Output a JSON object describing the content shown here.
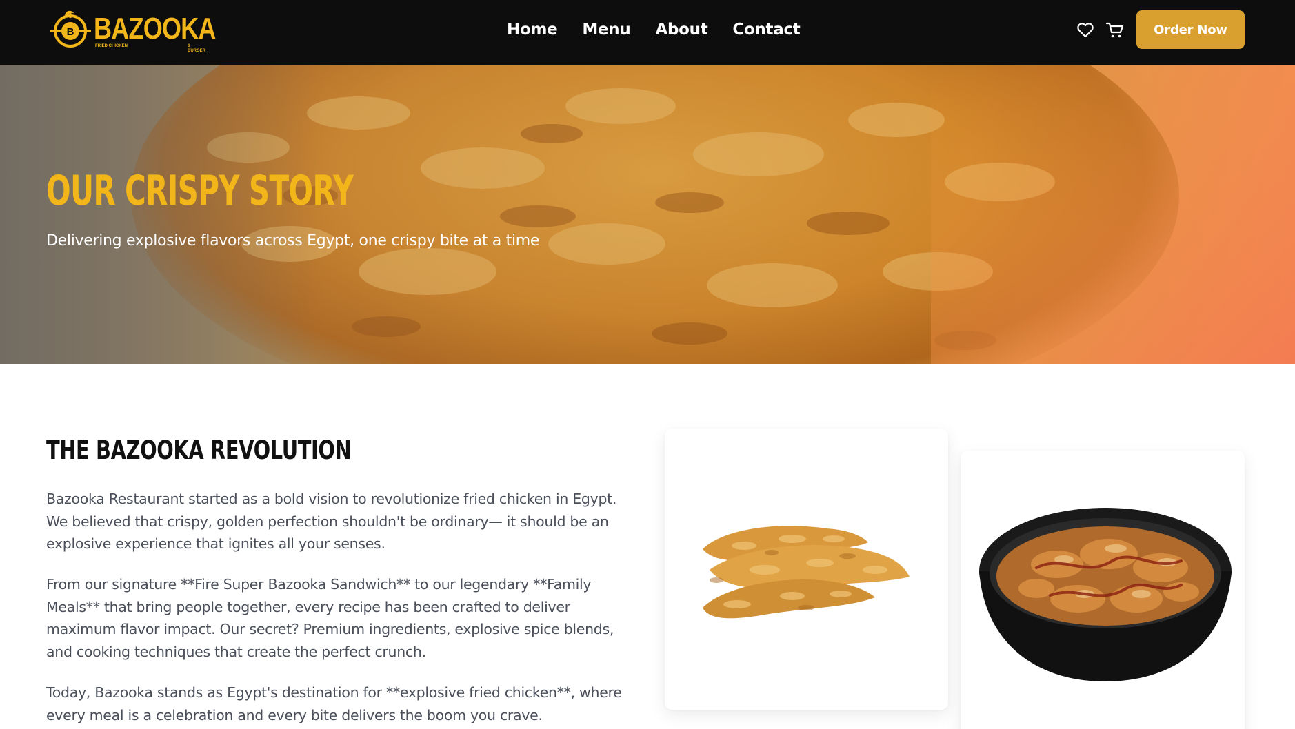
{
  "brand": {
    "name": "BAZOOKA",
    "tagline_left": "FRIED CHICKEN",
    "tagline_right": "& BURGER",
    "emblem_letter": "B",
    "accent_color": "#f2b51a"
  },
  "nav": {
    "links": [
      "Home",
      "Menu",
      "About",
      "Contact"
    ],
    "order_button": "Order Now",
    "icons": [
      "heart-icon",
      "cart-icon"
    ],
    "button_color": "#d9a02f"
  },
  "hero": {
    "title": "OUR CRISPY STORY",
    "subtitle": "Delivering explosive flavors across Egypt, one crispy bite at a time"
  },
  "story": {
    "title": "THE BAZOOKA REVOLUTION",
    "paragraphs": [
      "Bazooka Restaurant started as a bold vision to revolutionize fried chicken in Egypt. We believed that crispy, golden perfection shouldn't be ordinary— it should be an explosive experience that ignites all your senses.",
      "From our signature **Fire Super Bazooka Sandwich** to our legendary **Family Meals** that bring people together, every recipe has been crafted to deliver maximum flavor impact. Our secret? Premium ingredients, explosive spice blends, and cooking techniques that create the perfect crunch.",
      "Today, Bazooka stands as Egypt's destination for **explosive fried chicken**, where every meal is a celebration and every bite delivers the boom you crave."
    ]
  }
}
